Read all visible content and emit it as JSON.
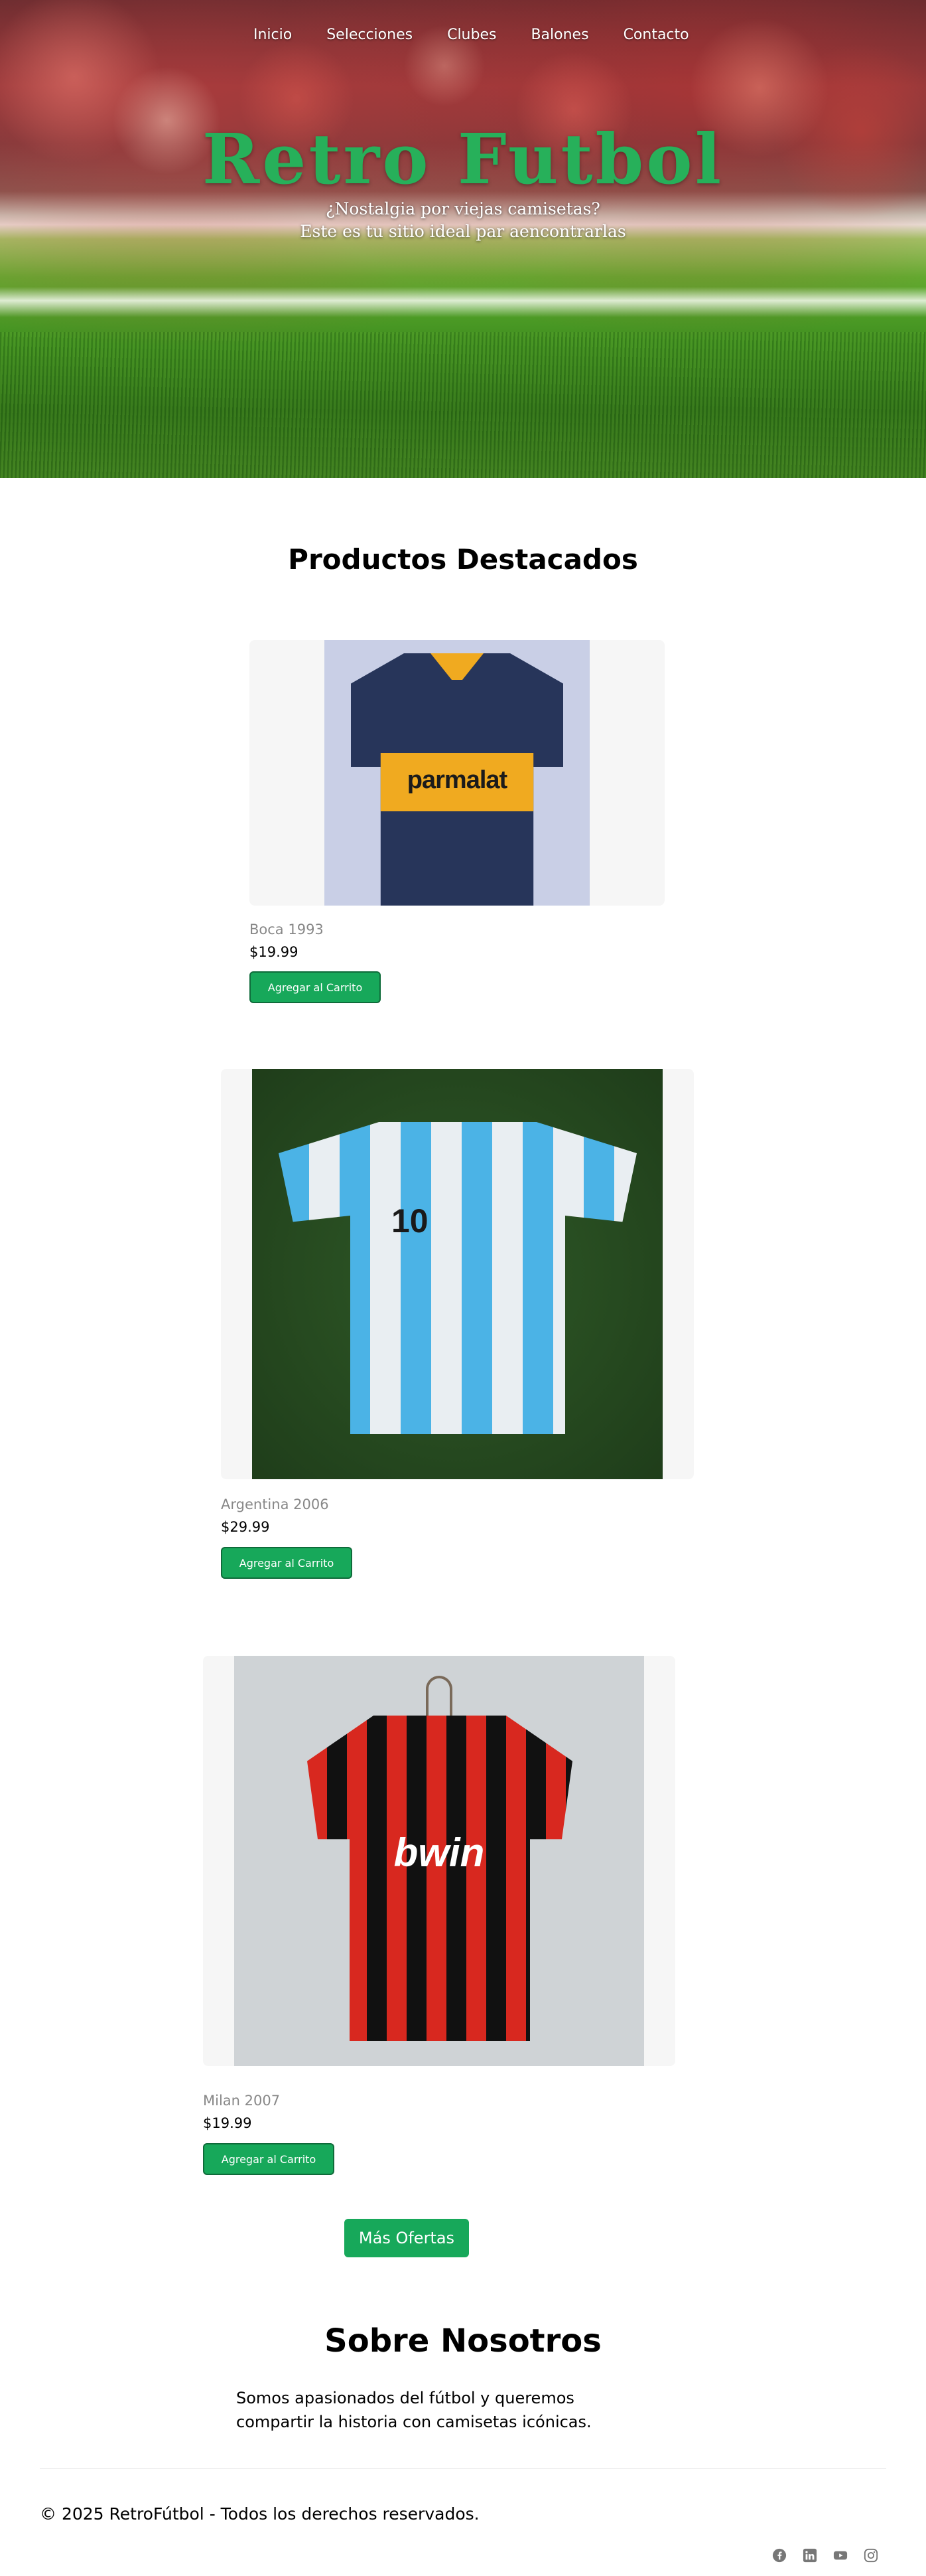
{
  "nav": {
    "items": [
      "Inicio",
      "Selecciones",
      "Clubes",
      "Balones",
      "Contacto"
    ]
  },
  "hero": {
    "title": "Retro Futbol",
    "subtitle_line1": "¿Nostalgia por viejas camisetas?",
    "subtitle_line2": "Este es tu sitio ideal par aencontrarlas"
  },
  "products": {
    "title": "Productos Destacados",
    "items": [
      {
        "name": "Boca 1993",
        "price": "$19.99",
        "button": "Agregar al Carrito",
        "sponsor": "parmalat"
      },
      {
        "name": "Argentina 2006",
        "price": "$29.99",
        "button": "Agregar al Carrito",
        "number": "10"
      },
      {
        "name": "Milan 2007",
        "price": "$19.99",
        "button": "Agregar al Carrito",
        "sponsor": "bwin"
      }
    ],
    "offers_button": "Más Ofertas"
  },
  "about": {
    "title": "Sobre Nosotros",
    "text": "Somos apasionados del fútbol y queremos compartir la historia con camisetas icónicas."
  },
  "footer": {
    "copyright": "© 2025 RetroFútbol - Todos los derechos reservados.",
    "socials": [
      "facebook-icon",
      "linkedin-icon",
      "youtube-icon",
      "instagram-icon"
    ]
  },
  "colors": {
    "accent": "#17a85a",
    "title_green": "#27b05a"
  }
}
